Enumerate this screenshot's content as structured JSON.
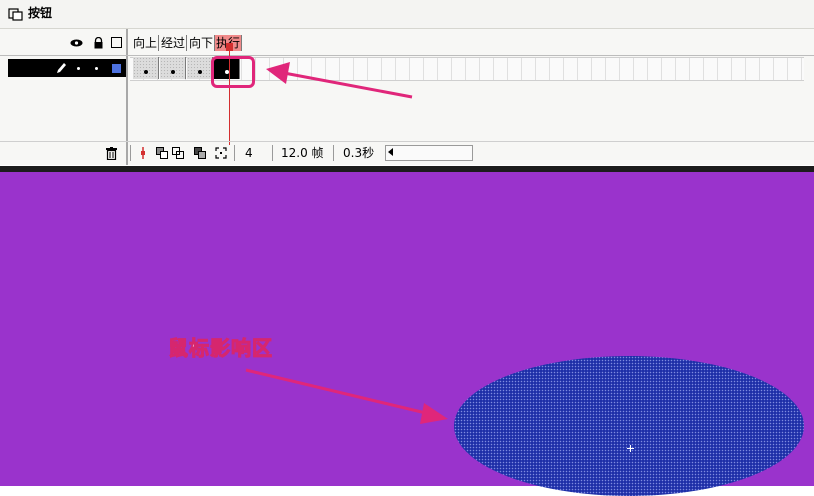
{
  "scene": {
    "title": "按钮"
  },
  "timeline": {
    "frame_labels": [
      "向上",
      "经过",
      "向下",
      "执行"
    ],
    "current_frame": "4",
    "frame_rate": "12.0 帧",
    "elapsed_time": "0.3秒"
  },
  "stage": {
    "annotation": "鼠标影响区"
  },
  "colors": {
    "stage_background": "#9a33cc",
    "hit_area_fill": "#1e2fa8",
    "annotation_pink": "#e0267a",
    "active_frame_label": "#f08a8a"
  },
  "icons": [
    "scene-icon",
    "eye-icon",
    "lock-icon",
    "outline-icon",
    "pencil-icon",
    "trash-icon",
    "onion-skin-icon",
    "edit-multiple-icon"
  ]
}
